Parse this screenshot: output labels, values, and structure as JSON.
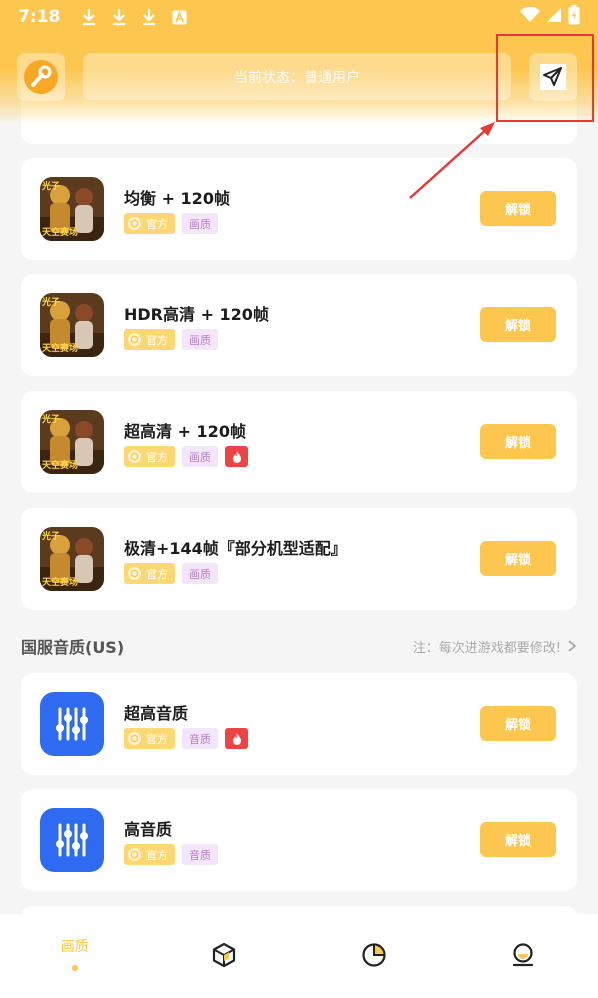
{
  "statusbar": {
    "time": "7:18",
    "left_icons": [
      "download-icon",
      "download-icon",
      "download-icon",
      "font-a-icon"
    ],
    "right_icons": [
      "wifi-icon",
      "signal-icon",
      "battery-icon"
    ]
  },
  "header": {
    "status_text": "当前状态：普通用户",
    "left_button_icon": "wrench-icon",
    "right_button_icon": "paper-plane-icon"
  },
  "colors": {
    "accent": "#fcc64f",
    "hot": "#ef4444",
    "annotation": "#e53935"
  },
  "quality_items": [
    {
      "title": "均衡 + 120帧",
      "tag_official": "官方",
      "tag_category": "画质",
      "hot": false,
      "button": "解锁"
    },
    {
      "title": "HDR高清 + 120帧",
      "tag_official": "官方",
      "tag_category": "画质",
      "hot": false,
      "button": "解锁"
    },
    {
      "title": "超高清 + 120帧",
      "tag_official": "官方",
      "tag_category": "画质",
      "hot": true,
      "button": "解锁"
    },
    {
      "title": "极清+144帧『部分机型适配』",
      "tag_official": "官方",
      "tag_category": "画质",
      "hot": false,
      "button": "解锁"
    }
  ],
  "audio_section": {
    "title": "国服音质(US)",
    "note": "注：每次进游戏都要修改!",
    "items": [
      {
        "title": "超高音质",
        "tag_official": "官方",
        "tag_category": "音质",
        "hot": true,
        "button": "解锁"
      },
      {
        "title": "高音质",
        "tag_official": "官方",
        "tag_category": "音质",
        "hot": false,
        "button": "解锁"
      }
    ]
  },
  "bottom_nav": {
    "items": [
      {
        "label": "画质",
        "active": true
      },
      {
        "icon": "cube-icon"
      },
      {
        "icon": "pie-chart-icon"
      },
      {
        "icon": "profile-icon"
      }
    ]
  }
}
